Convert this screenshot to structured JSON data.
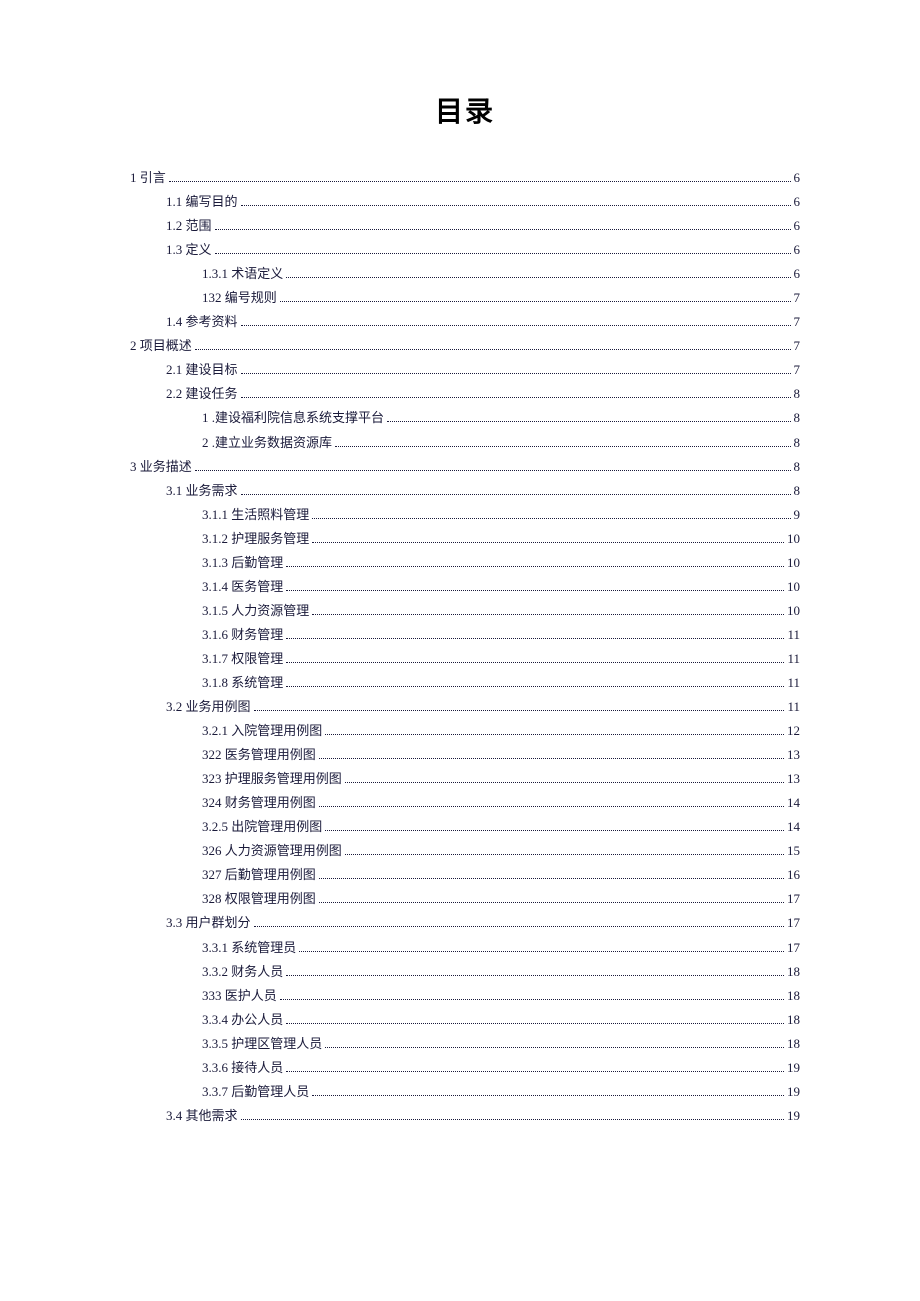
{
  "title": "目录",
  "toc": [
    {
      "indent": 0,
      "label": "1 引言",
      "page": "6"
    },
    {
      "indent": 1,
      "label": "1.1  编写目的",
      "page": "6"
    },
    {
      "indent": 1,
      "label": "1.2  范围",
      "page": "6"
    },
    {
      "indent": 1,
      "label": "1.3  定义",
      "page": "6"
    },
    {
      "indent": 2,
      "label": "1.3.1  术语定义",
      "page": "6"
    },
    {
      "indent": 2,
      "label": "132 编号规则",
      "page": "7"
    },
    {
      "indent": 1,
      "label": "1.4  参考资料",
      "page": "7"
    },
    {
      "indent": 0,
      "label": "2 项目概述",
      "page": "7"
    },
    {
      "indent": 1,
      "label": "2.1  建设目标",
      "page": "7"
    },
    {
      "indent": 1,
      "label": "2.2  建设任务",
      "page": " 8"
    },
    {
      "indent": 2,
      "label": "1   .建设福利院信息系统支撑平台",
      "page": "8"
    },
    {
      "indent": 2,
      "label": "2    .建立业务数据资源库",
      "page": " 8"
    },
    {
      "indent": 0,
      "label": "3 业务描述",
      "page": "8"
    },
    {
      "indent": 1,
      "label": "3.1  业务需求",
      "page": " 8"
    },
    {
      "indent": 2,
      "label": "3.1.1  生活照料管理",
      "page": " 9"
    },
    {
      "indent": 2,
      "label": "3.1.2  护理服务管理",
      "page": "10"
    },
    {
      "indent": 2,
      "label": "3.1.3  后勤管理",
      "page": "10"
    },
    {
      "indent": 2,
      "label": "3.1.4  医务管理",
      "page": "10"
    },
    {
      "indent": 2,
      "label": "3.1.5  人力资源管理",
      "page": "10"
    },
    {
      "indent": 2,
      "label": "3.1.6  财务管理",
      "page": "11"
    },
    {
      "indent": 2,
      "label": "3.1.7  权限管理",
      "page": "11"
    },
    {
      "indent": 2,
      "label": "3.1.8  系统管理",
      "page": "11"
    },
    {
      "indent": 1,
      "label": "3.2  业务用例图",
      "page": " 11"
    },
    {
      "indent": 2,
      "label": "3.2.1  入院管理用例图",
      "page": " 12"
    },
    {
      "indent": 2,
      "label": "322 医务管理用例图",
      "page": "13"
    },
    {
      "indent": 2,
      "label": "323 护理服务管理用例图",
      "page": "13"
    },
    {
      "indent": 2,
      "label": "324 财务管理用例图",
      "page": "14"
    },
    {
      "indent": 2,
      "label": "3.2.5  出院管理用例图",
      "page": "14"
    },
    {
      "indent": 2,
      "label": "326 人力资源管理用例图",
      "page": "15"
    },
    {
      "indent": 2,
      "label": "327 后勤管理用例图",
      "page": "16"
    },
    {
      "indent": 2,
      "label": "328 权限管理用例图",
      "page": "17"
    },
    {
      "indent": 1,
      "label": "3.3  用户群划分",
      "page": " 17"
    },
    {
      "indent": 2,
      "label": "3.3.1  系统管理员",
      "page": " 17"
    },
    {
      "indent": 2,
      "label": "3.3.2  财务人员",
      "page": "18"
    },
    {
      "indent": 2,
      "label": "333 医护人员",
      "page": " 18"
    },
    {
      "indent": 2,
      "label": "3.3.4  办公人员",
      "page": "18"
    },
    {
      "indent": 2,
      "label": "3.3.5  护理区管理人员",
      "page": "18"
    },
    {
      "indent": 2,
      "label": "3.3.6  接待人员",
      "page": "19"
    },
    {
      "indent": 2,
      "label": "3.3.7  后勤管理人员",
      "page": "19"
    },
    {
      "indent": 1,
      "label": "3.4  其他需求",
      "page": " 19"
    }
  ]
}
